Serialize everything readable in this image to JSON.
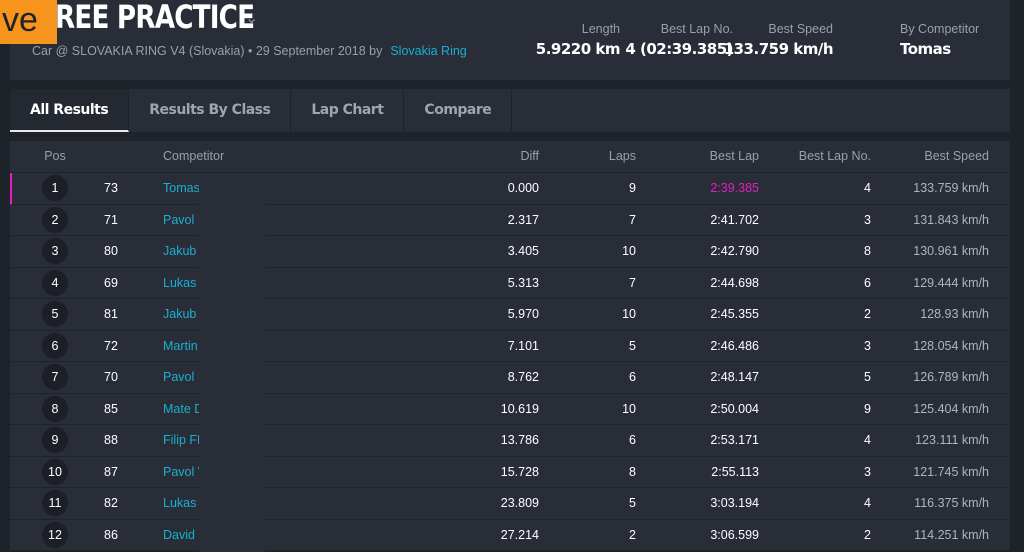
{
  "logo": "ve",
  "title": "REE PRACTICE",
  "subtitle": "Car @ SLOVAKIA RING V4 (Slovakia) • 29 September 2018 by",
  "organizer": "Slovakia Ring",
  "stats": [
    {
      "label": "Length",
      "value": "5.9220 km"
    },
    {
      "label": "Best Lap No.",
      "value": "4 (02:39.385)"
    },
    {
      "label": "Best Speed",
      "value": "133.759 km/h"
    },
    {
      "label": "By Competitor",
      "value": "Tomas"
    }
  ],
  "tabs": [
    "All Results",
    "Results By Class",
    "Lap Chart",
    "Compare"
  ],
  "columns": [
    "Pos",
    "Competitor",
    "Diff",
    "Laps",
    "Best Lap",
    "Best Lap No.",
    "Best Speed"
  ],
  "accent_best": "#e020c0",
  "rows": [
    [
      "1",
      "73",
      "Tomas",
      "0.000",
      "9",
      "2:39.385",
      "4",
      "133.759 km/h"
    ],
    [
      "2",
      "71",
      "Pavol I",
      "2.317",
      "7",
      "2:41.702",
      "3",
      "131.843 km/h"
    ],
    [
      "3",
      "80",
      "Jakub",
      "3.405",
      "10",
      "2:42.790",
      "8",
      "130.961 km/h"
    ],
    [
      "4",
      "69",
      "Lukas",
      "5.313",
      "7",
      "2:44.698",
      "6",
      "129.444 km/h"
    ],
    [
      "5",
      "81",
      "Jakub",
      "5.970",
      "10",
      "2:45.355",
      "2",
      "128.93 km/h"
    ],
    [
      "6",
      "72",
      "Martin",
      "7.101",
      "5",
      "2:46.486",
      "3",
      "128.054 km/h"
    ],
    [
      "7",
      "70",
      "Pavol I",
      "8.762",
      "6",
      "2:48.147",
      "5",
      "126.789 km/h"
    ],
    [
      "8",
      "85",
      "Mate D",
      "10.619",
      "10",
      "2:50.004",
      "9",
      "125.404 km/h"
    ],
    [
      "9",
      "88",
      "Filip FF",
      "13.786",
      "6",
      "2:53.171",
      "4",
      "123.111 km/h"
    ],
    [
      "10",
      "87",
      "Pavol V",
      "15.728",
      "8",
      "2:55.113",
      "3",
      "121.745 km/h"
    ],
    [
      "11",
      "82",
      "Lukas",
      "23.809",
      "5",
      "3:03.194",
      "4",
      "116.375 km/h"
    ],
    [
      "12",
      "86",
      "David I",
      "27.214",
      "2",
      "3:06.599",
      "2",
      "114.251 km/h"
    ]
  ]
}
